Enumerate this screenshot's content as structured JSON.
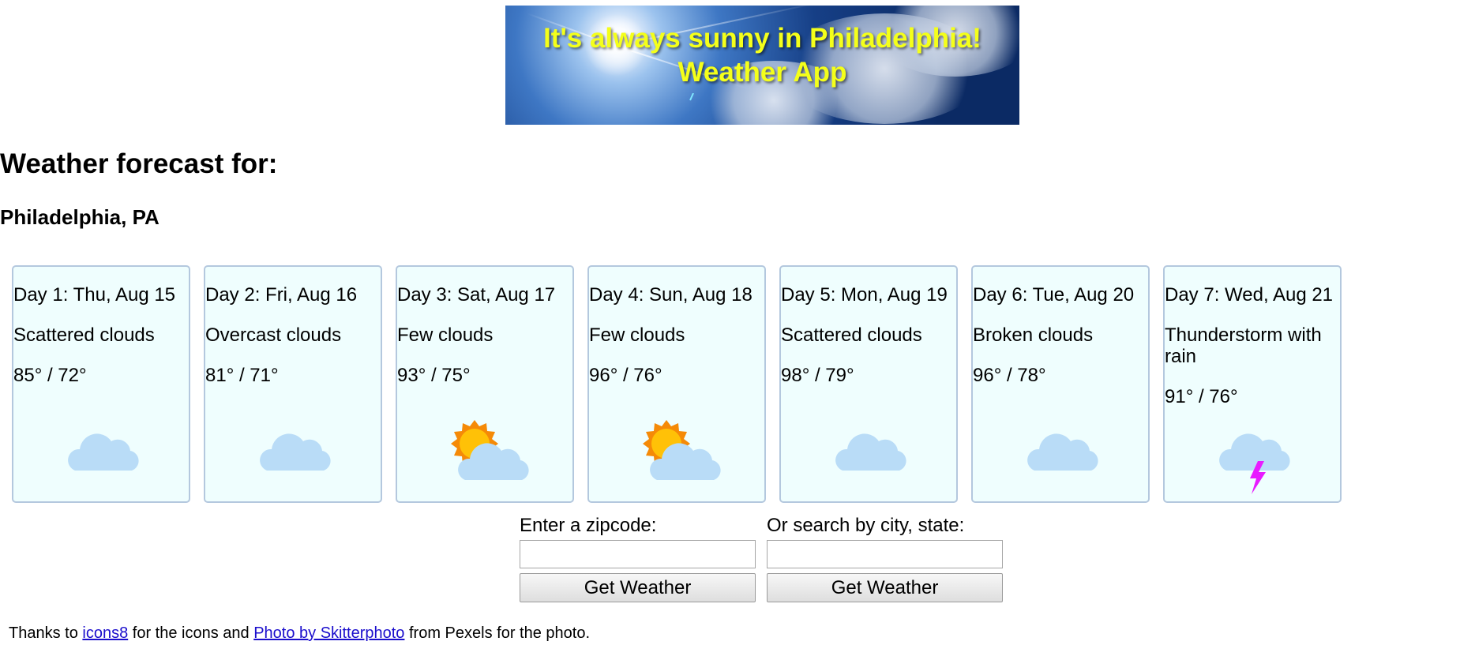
{
  "banner": {
    "title_line1": "It's always sunny in Philadelphia!",
    "title_line2": "Weather App"
  },
  "heading": "Weather forecast for:",
  "location": "Philadelphia, PA",
  "forecast": [
    {
      "date": "Day 1: Thu, Aug 15",
      "description": "Scattered clouds",
      "temps": "85° / 72°",
      "icon": "cloud-icon"
    },
    {
      "date": "Day 2: Fri, Aug 16",
      "description": "Overcast clouds",
      "temps": "81° / 71°",
      "icon": "cloud-icon"
    },
    {
      "date": "Day 3: Sat, Aug 17",
      "description": "Few clouds",
      "temps": "93° / 75°",
      "icon": "partly-sunny-icon"
    },
    {
      "date": "Day 4: Sun, Aug 18",
      "description": "Few clouds",
      "temps": "96° / 76°",
      "icon": "partly-sunny-icon"
    },
    {
      "date": "Day 5: Mon, Aug 19",
      "description": "Scattered clouds",
      "temps": "98° / 79°",
      "icon": "cloud-icon"
    },
    {
      "date": "Day 6: Tue, Aug 20",
      "description": "Broken clouds",
      "temps": "96° / 78°",
      "icon": "cloud-icon"
    },
    {
      "date": "Day 7: Wed, Aug 21",
      "description": "Thunderstorm with rain",
      "temps": "91° / 76°",
      "icon": "thunderstorm-icon"
    }
  ],
  "zip_search": {
    "label": "Enter a zipcode:",
    "value": "",
    "button": "Get Weather"
  },
  "city_search": {
    "label": "Or search by city, state:",
    "value": "",
    "button": "Get Weather"
  },
  "credits": {
    "prefix": "Thanks to",
    "icons_link": "icons8",
    "middle": "for the icons and",
    "photo_link": "Photo by Skitterphoto",
    "suffix": "from Pexels for the photo."
  },
  "colors": {
    "card_bg": "#effefe",
    "card_border": "#b4c8de",
    "cloud": "#b9dcf7",
    "sun": "#ffc107",
    "sun_ring": "#f58a07",
    "lightning": "#e81bff",
    "banner_text": "#f4ff1a",
    "link": "#1a0dcc"
  }
}
